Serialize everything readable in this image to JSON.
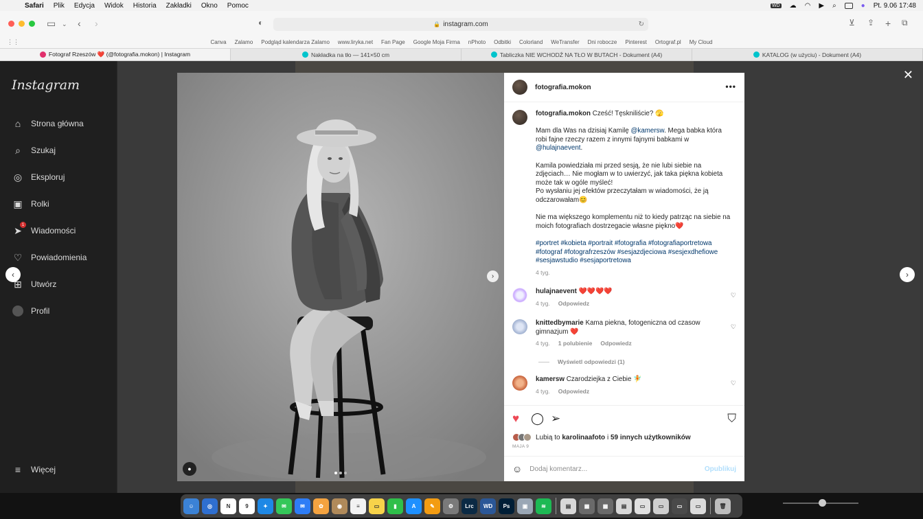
{
  "menubar": {
    "items": [
      "Safari",
      "Plik",
      "Edycja",
      "Widok",
      "Historia",
      "Zakładki",
      "Okno",
      "Pomoc"
    ],
    "clock": "Pt. 9.06  17:48"
  },
  "browser": {
    "url": "instagram.com",
    "favorites": [
      "Canva",
      "Zalamo",
      "Podgląd kalendarza Zalamo",
      "www.liryka.net",
      "Fan Page",
      "Google Moja Firma",
      "nPhoto",
      "Odbitki",
      "Colorland",
      "WeTransfer",
      "Dni robocze",
      "Pinterest",
      "Ortograf.pl",
      "My Cloud"
    ],
    "tabs": [
      {
        "label": "Fotograf Rzeszów ❤️ (@fotografia.mokon) | Instagram",
        "color": "#e1306c"
      },
      {
        "label": "Nakładka na tło — 141×50 cm",
        "color": "#00c4cc"
      },
      {
        "label": "Tabliczka NIE WCHODŹ NA TŁO W BUTACH - Dokument (A4)",
        "color": "#00c4cc"
      },
      {
        "label": "KATALOG (w użyciu) - Dokument (A4)",
        "color": "#00c4cc"
      }
    ]
  },
  "sidebar": {
    "logo": "Instagram",
    "items": [
      {
        "label": "Strona główna",
        "icon": "home-icon"
      },
      {
        "label": "Szukaj",
        "icon": "search-icon"
      },
      {
        "label": "Eksploruj",
        "icon": "compass-icon"
      },
      {
        "label": "Rolki",
        "icon": "reels-icon"
      },
      {
        "label": "Wiadomości",
        "icon": "messenger-icon",
        "badge": "1"
      },
      {
        "label": "Powiadomienia",
        "icon": "heart-icon"
      },
      {
        "label": "Utwórz",
        "icon": "plus-square-icon"
      },
      {
        "label": "Profil",
        "icon": "profile-avatar"
      }
    ],
    "more": "Więcej"
  },
  "post": {
    "username": "fotografia.mokon",
    "caption": {
      "username": "fotografia.mokon",
      "p1": "Cześć! Tęskniliście? 🫣",
      "p2_a": "Mam dla Was na dzisiaj Kamilę ",
      "p2_link1": "@kamersw",
      "p2_b": ". Mega babka która robi fajne rzeczy razem z innymi fajnymi babkami w ",
      "p2_link2": "@hulajnaevent",
      "p2_c": ".",
      "p3": "Kamila powiedziała mi przed sesją, że nie lubi siebie na zdjęciach… Nie mogłam w to uwierzyć, jak taka piękna kobieta może tak w ogóle myśleć!",
      "p3b": "Po wysłaniu jej efektów przeczytałam w wiadomości, że ją odczarowałam😊",
      "p4": "Nie ma większego komplementu niż to kiedy patrząc na siebie na moich fotografiach dostrzegacie własne piękno❤️",
      "hashtags": "#portret #kobieta #portrait #fotografia #fotografiaportretowa #fotograf #fotografrzeszów #sesjazdjeciowa #sesjexdhefiowe #sesjawstudio #sesjaportretowa",
      "time": "4 tyg."
    },
    "comments": [
      {
        "username": "hulajnaevent",
        "text": "❤️❤️❤️❤️",
        "time": "4 tyg.",
        "reply": "Odpowiedz"
      },
      {
        "username": "knittedbymarie",
        "text": "Kama piekna, fotogeniczna od czasow gimnazjum ❤️",
        "time": "4 tyg.",
        "likes": "1 polubienie",
        "reply": "Odpowiedz",
        "view_replies": "Wyświetl odpowiedzi (1)"
      },
      {
        "username": "kamersw",
        "text": "Czarodziejka z Ciebie 🧚",
        "time": "4 tyg.",
        "reply": "Odpowiedz"
      }
    ],
    "likes_prefix": "Lubią to ",
    "likes_user": "karolinaafoto",
    "likes_mid": " i ",
    "likes_count": "59 innych użytkowników",
    "date": "MAJA 9",
    "comment_placeholder": "Dodaj komentarz...",
    "post_button": "Opublikuj"
  },
  "dock": {
    "calendar_day": "9",
    "apps": [
      {
        "name": "finder",
        "color": "#3b82d6",
        "glyph": "☺"
      },
      {
        "name": "safari-alt",
        "color": "#2f6fd0",
        "glyph": "◎"
      },
      {
        "name": "notion",
        "color": "#ffffff",
        "glyph": "N"
      },
      {
        "name": "calendar",
        "color": "#ffffff",
        "glyph": "9"
      },
      {
        "name": "safari",
        "color": "#1e88e5",
        "glyph": "✦"
      },
      {
        "name": "messages",
        "color": "#34c759",
        "glyph": "✉"
      },
      {
        "name": "mail",
        "color": "#2e7df6",
        "glyph": "✉"
      },
      {
        "name": "photos",
        "color": "#f4a340",
        "glyph": "✿"
      },
      {
        "name": "contacts",
        "color": "#b08a5a",
        "glyph": "◉"
      },
      {
        "name": "reminders",
        "color": "#f2f2f2",
        "glyph": "≡"
      },
      {
        "name": "notes",
        "color": "#f7d34a",
        "glyph": "▭"
      },
      {
        "name": "numbers",
        "color": "#2fbf4a",
        "glyph": "▮"
      },
      {
        "name": "app-store",
        "color": "#1e90ff",
        "glyph": "A"
      },
      {
        "name": "pages",
        "color": "#f39c12",
        "glyph": "✎"
      },
      {
        "name": "system-prefs",
        "color": "#7a7a7a",
        "glyph": "⚙"
      },
      {
        "name": "lightroom",
        "color": "#0b2a44",
        "glyph": "Lrc"
      },
      {
        "name": "word",
        "color": "#2b5797",
        "glyph": "WD"
      },
      {
        "name": "photoshop",
        "color": "#001e36",
        "glyph": "Ps"
      },
      {
        "name": "preview",
        "color": "#9aa7b5",
        "glyph": "▣"
      },
      {
        "name": "spotify",
        "color": "#1db954",
        "glyph": "≋"
      },
      {
        "name": "file-1",
        "color": "#d8d8d8",
        "glyph": "▤"
      },
      {
        "name": "grid-1",
        "color": "#6a6a6a",
        "glyph": "▦"
      },
      {
        "name": "grid-2",
        "color": "#6a6a6a",
        "glyph": "▦"
      },
      {
        "name": "file-2",
        "color": "#d8d8d8",
        "glyph": "▤"
      },
      {
        "name": "file-3",
        "color": "#e0e0e0",
        "glyph": "▭"
      },
      {
        "name": "file-4",
        "color": "#cfcfcf",
        "glyph": "▭"
      },
      {
        "name": "file-5",
        "color": "#4a4a4a",
        "glyph": "▭"
      },
      {
        "name": "file-6",
        "color": "#dcdcdc",
        "glyph": "▭"
      },
      {
        "name": "trash",
        "color": "#bdbdbd",
        "glyph": "🗑"
      }
    ]
  }
}
